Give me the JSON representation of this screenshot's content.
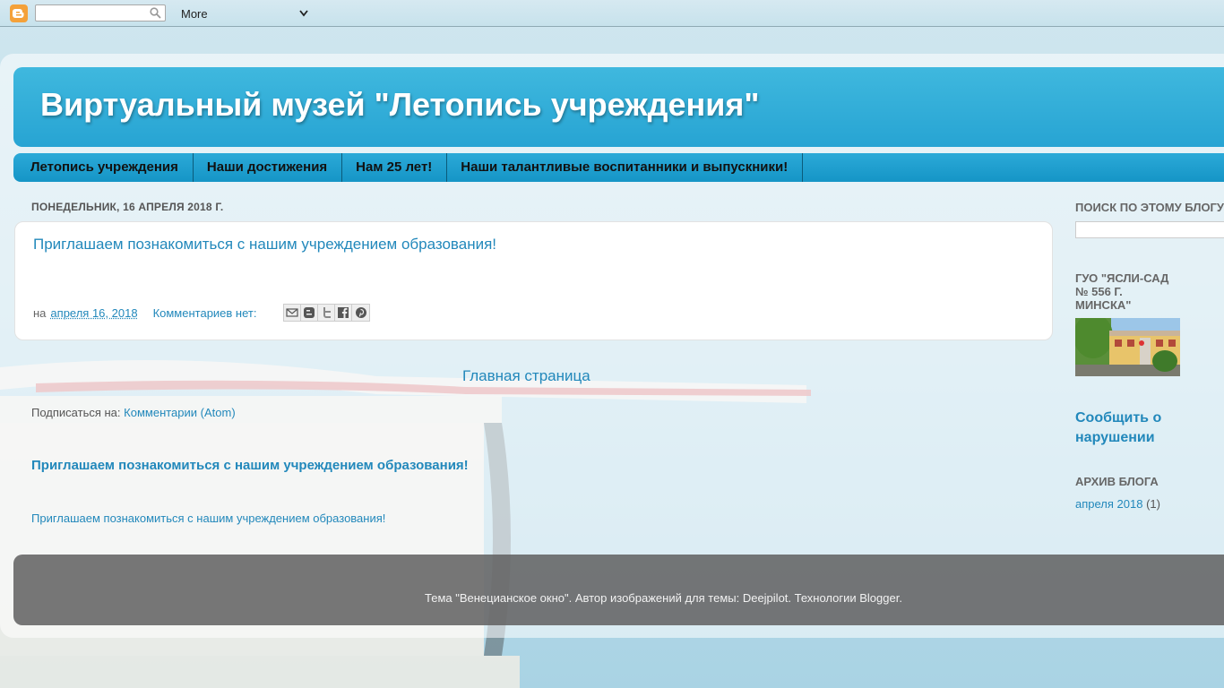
{
  "navbar": {
    "search_placeholder": "",
    "more_label": "More"
  },
  "header": {
    "title": "Виртуальный музей \"Летопись учреждения\""
  },
  "tabs": [
    {
      "label": "Летопись учреждения"
    },
    {
      "label": "Наши достижения"
    },
    {
      "label": "Нам 25 лет!"
    },
    {
      "label": "Наши талантливые воспитанники и выпускники!"
    }
  ],
  "post": {
    "date_header": "ПОНЕДЕЛЬНИК, 16 АПРЕЛЯ 2018 Г.",
    "title": "Приглашаем познакомиться с нашим учреждением образования!",
    "footer_prefix": "на",
    "date_link": "апреля 16, 2018",
    "comments_link": "Комментариев нет:"
  },
  "main": {
    "home_link": "Главная страница",
    "subscribe_prefix": "Подписаться на:",
    "subscribe_link": "Комментарии (Atom)",
    "popular_title": "Приглашаем познакомиться с нашим учреждением образования!",
    "popular_snippet": "Приглашаем познакомиться с нашим учреждением образования!"
  },
  "sidebar": {
    "search_heading": "ПОИСК ПО ЭТОМУ БЛОГУ",
    "profile_heading_line1": "ГУО \"ЯСЛИ-САД",
    "profile_heading_line2": "№ 556 Г.",
    "profile_heading_line3": "МИНСКА\"",
    "report_line1": "Сообщить о",
    "report_line2": "нарушении",
    "archive_heading": "АРХИВ БЛОГА",
    "archive_link": "апреля 2018",
    "archive_count": "(1)"
  },
  "footer": {
    "text": "Тема \"Венецианское окно\". Автор изображений для темы: Deejpilot. Технологии Blogger."
  },
  "colors": {
    "link": "#2288bb",
    "header_blue": "#27a4d3",
    "footer_gray": "#5f5f5f"
  }
}
